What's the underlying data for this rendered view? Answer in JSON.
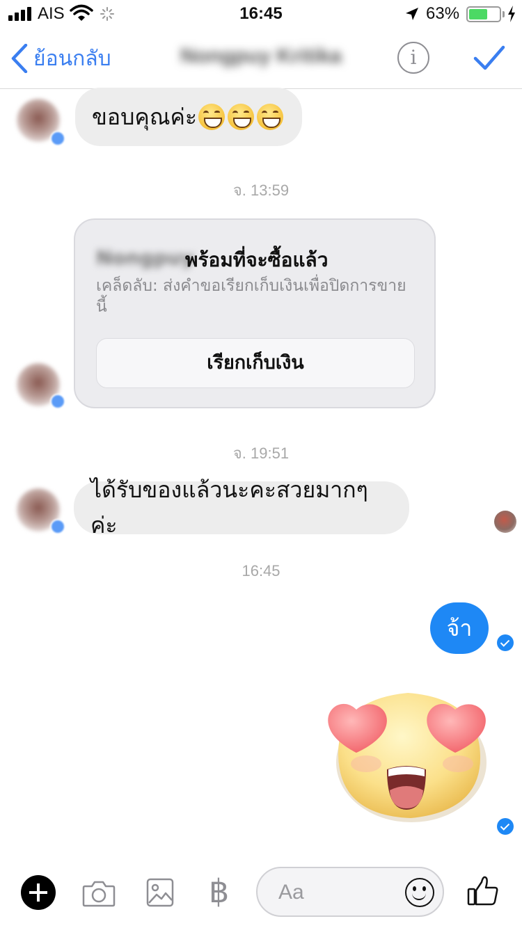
{
  "status_bar": {
    "carrier": "AIS",
    "time": "16:45",
    "battery_percent": "63%",
    "battery_level": 0.63
  },
  "nav": {
    "back_label": "ย้อนกลับ",
    "title": "Nongpuy Kritika",
    "info_glyph": "i"
  },
  "messages": {
    "m1_text": "ขอบคุณค่ะ",
    "ts1": "จ. 13:59",
    "card": {
      "sender": "Nongpuy",
      "title": "พร้อมที่จะซื้อแล้ว",
      "subtitle": "เคล็ดลับ: ส่งคำขอเรียกเก็บเงินเพื่อปิดการขายนี้",
      "button": "เรียกเก็บเงิน"
    },
    "ts2": "จ. 19:51",
    "m3_text": "ได้รับของแล้วนะคะสวยมากๆค่ะ",
    "ts3": "16:45",
    "out_text": "จ้า"
  },
  "composer": {
    "placeholder": "Aa",
    "currency_glyph": "฿"
  },
  "icons": [
    "signal-icon",
    "wifi-icon",
    "location-icon",
    "battery-icon",
    "back-chevron-icon",
    "info-icon",
    "checkmark-icon",
    "plus-icon",
    "camera-icon",
    "image-icon",
    "baht-icon",
    "emoji-icon",
    "thumbs-up-icon"
  ],
  "colors": {
    "accent": "#1e88f5",
    "nav_accent": "#3a7ef0",
    "incoming_bubble": "#ededed"
  }
}
